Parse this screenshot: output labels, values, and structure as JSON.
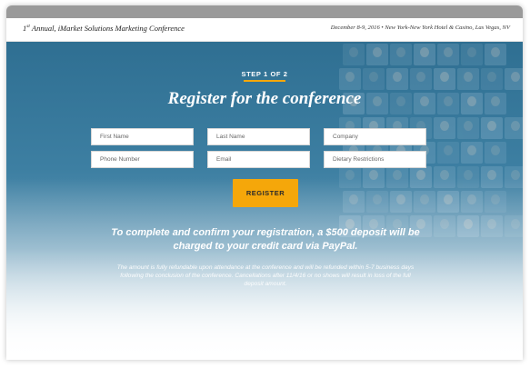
{
  "header": {
    "title_ordinal": "1",
    "title_suffix": "st",
    "title_text": " Annual, iMarket Solutions Marketing Conference",
    "event_info": "December 8-9, 2016 • New York-New York Hotel & Casino, Las Vegas, NV"
  },
  "hero": {
    "step_label": "STEP 1 OF 2",
    "headline": "Register for the conference",
    "accent_color": "#f5a70a",
    "background_color": "#3d7fa2"
  },
  "form": {
    "first_name_placeholder": "First Name",
    "last_name_placeholder": "Last Name",
    "company_placeholder": "Company",
    "phone_placeholder": "Phone Number",
    "email_placeholder": "Email",
    "dietary_placeholder": "Dietary Restrictions",
    "register_label": "REGISTER"
  },
  "notice": {
    "deposit_text": "To complete and confirm your registration, a $500 deposit will be charged to your credit card via PayPal.",
    "terms_text": "The amount is fully refundable upon attendance at the conference and will be refunded within 5-7 business days following the conclusion of the conference. Cancellations after 11/4/16 or no shows will result in loss of the full deposit amount."
  }
}
